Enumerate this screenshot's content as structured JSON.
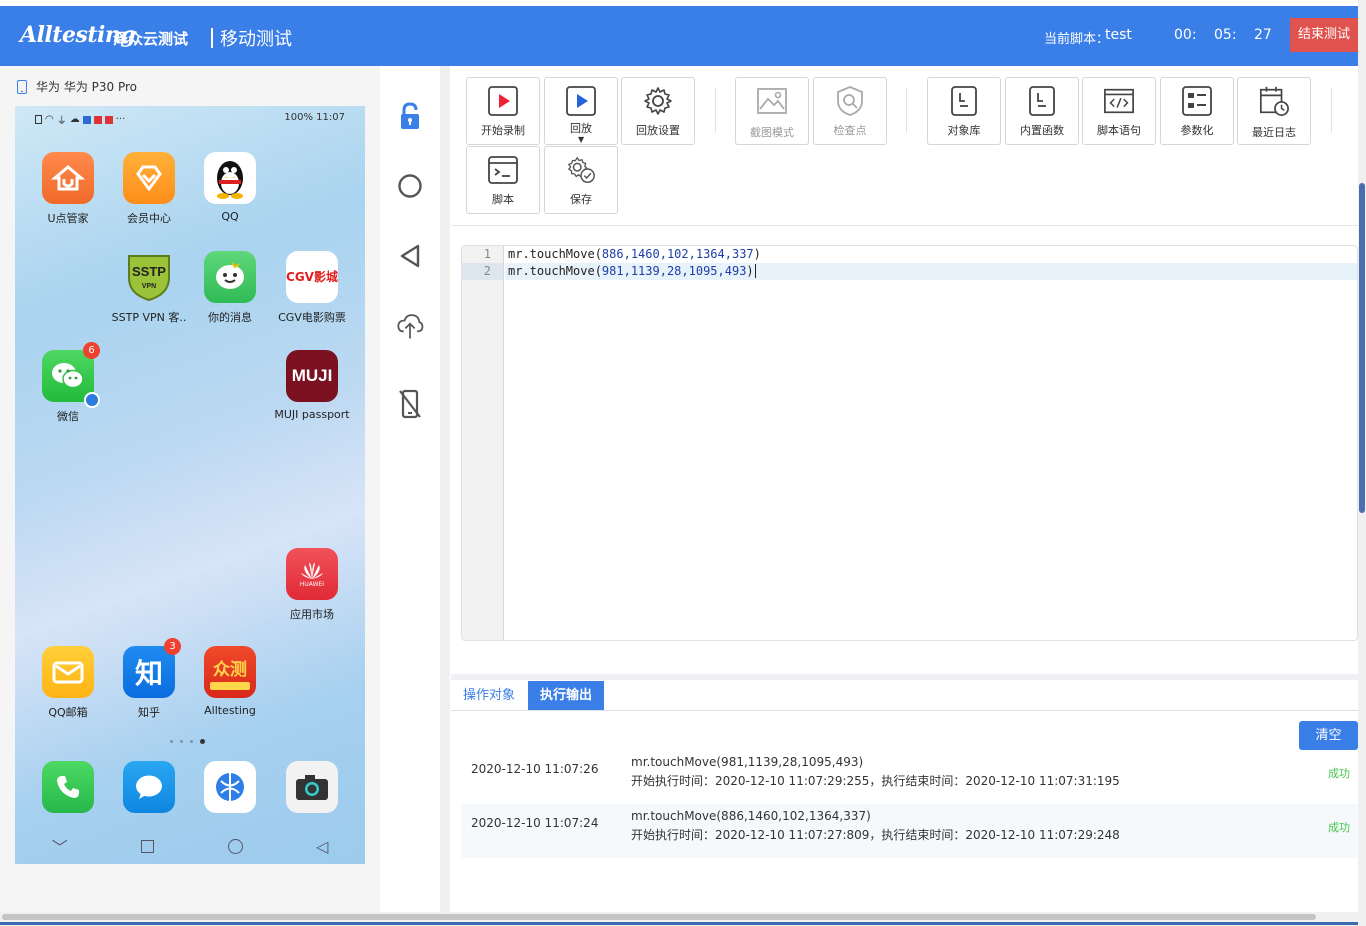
{
  "header": {
    "logo_text": "Alltesting",
    "logo_sub": "泽众云测试",
    "page_title": "移动测试",
    "current_script_label": "当前脚本：",
    "current_script_value": "test",
    "timer_hours": "00:",
    "timer_minutes": "05:",
    "timer_seconds": "27",
    "end_button": "结束测试"
  },
  "device": {
    "name": "华为 华为 P30 Pro",
    "status_right": "100%  11:07",
    "apps": [
      {
        "label": "U点管家"
      },
      {
        "label": "会员中心"
      },
      {
        "label": "QQ"
      },
      {
        "label": "SSTP VPN 客..",
        "icon_text": "SSTP"
      },
      {
        "label": "你的消息"
      },
      {
        "label": "CGV电影购票",
        "icon_text": "CGV影城"
      },
      {
        "label": "微信",
        "badge": "6"
      },
      {
        "label": "MUJI passport",
        "icon_text": "MUJI"
      },
      {
        "label": "应用市场",
        "icon_text": "HUAWEI"
      },
      {
        "label": "QQ邮箱"
      },
      {
        "label": "知乎",
        "icon_text": "知",
        "badge": "3"
      },
      {
        "label": "Alltesting",
        "icon_text": "众测"
      }
    ],
    "dock": [
      "phone-icon",
      "messages-icon",
      "browser-icon",
      "camera-icon"
    ]
  },
  "sidebar": [
    "lock-icon",
    "home-circle-icon",
    "back-triangle-icon",
    "upload-cloud-icon",
    "no-phone-icon"
  ],
  "toolbar": {
    "start_record": "开始录制",
    "replay": "回放",
    "replay_settings": "回放设置",
    "screenshot_mode": "截图模式",
    "checkpoint": "检查点",
    "object_library": "对象库",
    "builtin_functions": "内置函数",
    "script_statement": "脚本语句",
    "parameterize": "参数化",
    "recent_logs": "最近日志",
    "script": "脚本",
    "save": "保存"
  },
  "editor": {
    "line_numbers": [
      "1",
      "2"
    ],
    "lines": [
      {
        "fn": "mr.touchMove(",
        "args": "886,1460,102,1364,337",
        "end": ")"
      },
      {
        "fn": "mr.touchMove(",
        "args": "981,1139,28,1095,493",
        "end": ")"
      }
    ]
  },
  "output": {
    "tab_objects": "操作对象",
    "tab_output": "执行输出",
    "clear_button": "清空",
    "rows": [
      {
        "time": "2020-12-10 11:07:26",
        "command": "mr.touchMove(981,1139,28,1095,493)",
        "detail": "开始执行时间：2020-12-10 11:07:29:255，执行结束时间：2020-12-10 11:07:31:195",
        "status": "成功"
      },
      {
        "time": "2020-12-10 11:07:24",
        "command": "mr.touchMove(886,1460,102,1364,337)",
        "detail": "开始执行时间：2020-12-10 11:07:27:809，执行结束时间：2020-12-10 11:07:29:248",
        "status": "成功"
      }
    ]
  },
  "colors": {
    "brand_blue": "#3a7ee8",
    "end_red": "#e0524e",
    "success_green": "#47c44c"
  }
}
